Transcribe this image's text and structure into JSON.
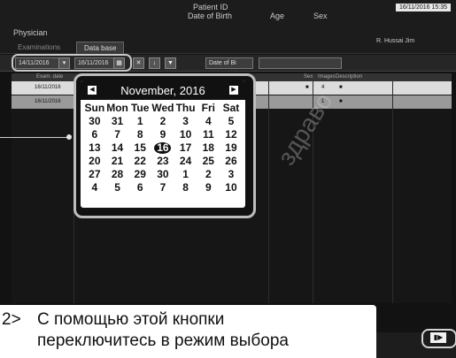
{
  "header": {
    "patient_id_label": "Patient ID",
    "dob_label": "Date of Birth",
    "age_label": "Age",
    "sex_label": "Sex",
    "physician_label": "Physician",
    "datetime": "16/11/2016 15:35",
    "user_label": "R. Hussai Jim"
  },
  "tabs": [
    {
      "label": "Examinations"
    },
    {
      "label": "Data base"
    }
  ],
  "filters": {
    "date_from": "14/11/2016",
    "date_to": "16/11/2016",
    "date_from_field_label": "Date of Bi"
  },
  "grid": {
    "headers": {
      "exam_date": "Exam. date",
      "sex": "Sex",
      "images": "Images",
      "description": "Description"
    },
    "rows": [
      {
        "exam_date": "16/11/2016",
        "sex": "■",
        "images": "4",
        "description": "■"
      },
      {
        "exam_date": "16/11/2016",
        "sex": "",
        "images": "1",
        "description": "■"
      }
    ]
  },
  "calendar": {
    "title": "November, 2016",
    "weekdays": [
      "Sun",
      "Mon",
      "Tue",
      "Wed",
      "Thu",
      "Fri",
      "Sat"
    ],
    "weeks": [
      [
        "30",
        "31",
        "1",
        "2",
        "3",
        "4",
        "5"
      ],
      [
        "6",
        "7",
        "8",
        "9",
        "10",
        "11",
        "12"
      ],
      [
        "13",
        "14",
        "15",
        "16",
        "17",
        "18",
        "19"
      ],
      [
        "20",
        "21",
        "22",
        "23",
        "24",
        "25",
        "26"
      ],
      [
        "27",
        "28",
        "29",
        "30",
        "1",
        "2",
        "3"
      ],
      [
        "4",
        "5",
        "6",
        "7",
        "8",
        "9",
        "10"
      ]
    ],
    "selected_day": "16"
  },
  "instruction": {
    "number": "2>",
    "line1": "С помощью этой кнопки",
    "line2": "переключитесь в режим выбора"
  },
  "colors": {
    "background": "#121212",
    "accent": "#ffffff"
  }
}
